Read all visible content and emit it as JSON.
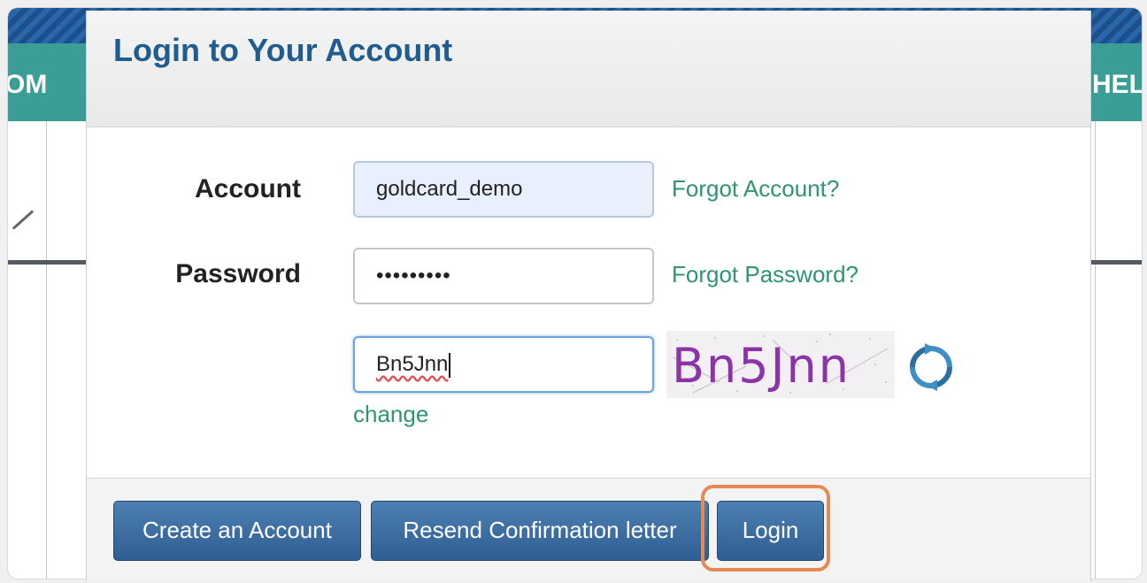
{
  "background": {
    "nav_left_fragment": "OM",
    "nav_right_fragment": "HEL"
  },
  "modal": {
    "title": "Login to Your Account",
    "account": {
      "label": "Account",
      "value": "goldcard_demo",
      "forgot_link": "Forgot Account?"
    },
    "password": {
      "label": "Password",
      "masked_value": "•••••••••",
      "forgot_link": "Forgot Password?"
    },
    "captcha": {
      "input_value": "Bn5Jnn",
      "image_text": "Bn5Jnn",
      "change_link": "change",
      "refresh_icon": "refresh-icon"
    },
    "buttons": {
      "create_account": "Create an Account",
      "resend_confirmation": "Resend Confirmation letter",
      "login": "Login"
    }
  },
  "colors": {
    "title": "#215c8e",
    "link": "#2e9474",
    "button": "#2f5f92",
    "highlight": "#e58a55",
    "captcha": "#8a34a8",
    "teal_band": "#3a9e97"
  }
}
